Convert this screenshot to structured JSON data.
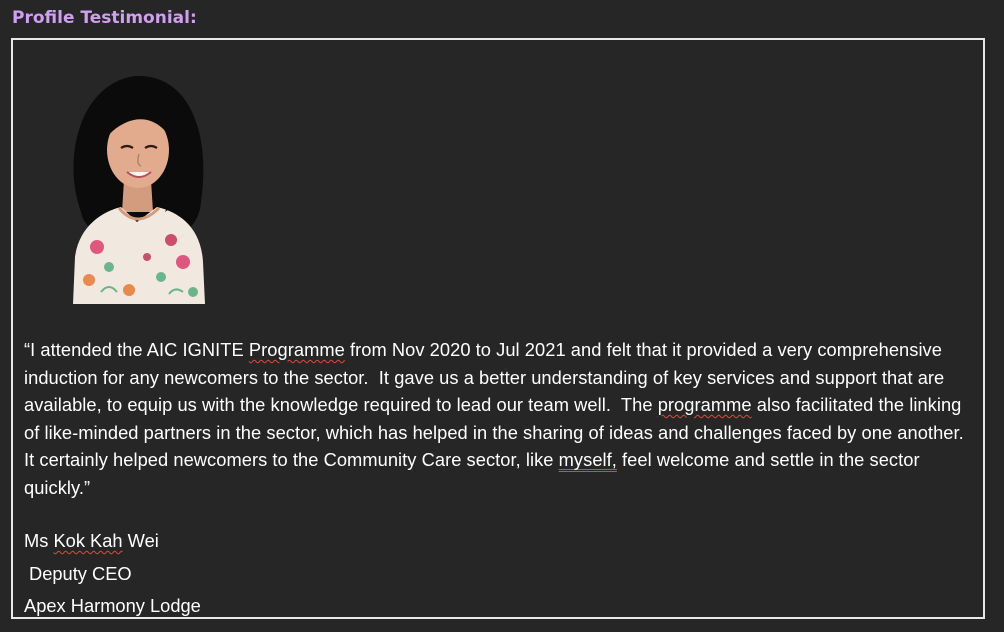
{
  "heading": "Profile Testimonial:",
  "quote": {
    "text_1": "“I attended the AIC IGNITE ",
    "spell_1": "Programme",
    "text_2": " from Nov 2020 to Jul 2021 and felt that it provided a very comprehensive induction for any newcomers to the sector.  It gave us a better understanding of key services and support that are available, to equip us with the knowledge required to lead our team well.  The ",
    "spell_2": "programme",
    "text_3": " also facilitated the linking of like-minded partners in the sector, which has helped in the sharing of ideas and challenges faced by one another. It certainly helped newcomers to the Community Care sector, like ",
    "grammar_1": "myself,",
    "text_4": " feel welcome and settle in the sector quickly.”"
  },
  "signature": {
    "prefix": "Ms ",
    "name_flagged": "Kok Kah",
    "suffix": " Wei",
    "title": "Deputy CEO",
    "organisation": "Apex Harmony Lodge"
  },
  "portrait": {
    "icon": "person-portrait-icon",
    "hair_color": "#0b0b0b",
    "skin_color": "#e2ab8d",
    "blouse_color": "#f1e9df",
    "flower_colors": [
      "#e0577e",
      "#6cb48a",
      "#e88a4e",
      "#c94f6d"
    ]
  }
}
